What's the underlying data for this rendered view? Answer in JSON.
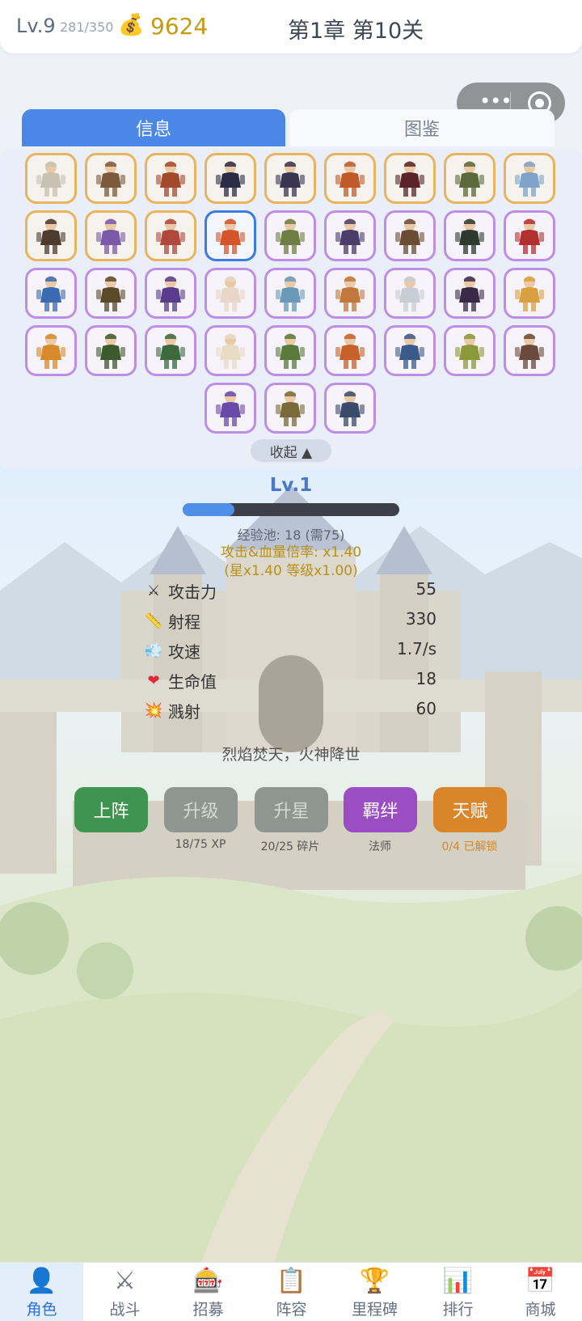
{
  "player": {
    "level": "Lv.9",
    "xp": "281/350",
    "coin_icon": "money-bag-icon",
    "gold": "9624"
  },
  "stage": {
    "label": "第1章 第10关"
  },
  "tabs": [
    {
      "label": "信息",
      "active": true
    },
    {
      "label": "图鉴",
      "active": false
    }
  ],
  "roster": {
    "collapse_label": "收起 ▲",
    "rows": [
      [
        {
          "rarity": "gold",
          "color": "#c9c2b0"
        },
        {
          "rarity": "gold",
          "color": "#7d5a3c"
        },
        {
          "rarity": "gold",
          "color": "#a44a2c"
        },
        {
          "rarity": "gold",
          "color": "#2c2c44"
        },
        {
          "rarity": "gold",
          "color": "#3a3550"
        },
        {
          "rarity": "gold",
          "color": "#c05a2a"
        },
        {
          "rarity": "gold",
          "color": "#5a2428"
        },
        {
          "rarity": "gold",
          "color": "#5b6a3a"
        },
        {
          "rarity": "gold",
          "color": "#7fa3c9"
        }
      ],
      [
        {
          "rarity": "gold",
          "color": "#4e3a2e"
        },
        {
          "rarity": "gold",
          "color": "#7a5aa8"
        },
        {
          "rarity": "gold",
          "color": "#b0483c"
        },
        {
          "rarity": "selected",
          "color": "#d4552a"
        },
        {
          "rarity": "purple",
          "color": "#6f7f44"
        },
        {
          "rarity": "purple",
          "color": "#4c3c6a"
        },
        {
          "rarity": "purple",
          "color": "#6a4c34"
        },
        {
          "rarity": "purple",
          "color": "#2e3a2e"
        },
        {
          "rarity": "purple",
          "color": "#b23030"
        }
      ],
      [
        {
          "rarity": "purple",
          "color": "#3c6ab0"
        },
        {
          "rarity": "purple",
          "color": "#5a4a2a"
        },
        {
          "rarity": "purple",
          "color": "#5a3c8c"
        },
        {
          "rarity": "purple",
          "color": "#e8d6c8"
        },
        {
          "rarity": "purple",
          "color": "#6a9ab8"
        },
        {
          "rarity": "purple",
          "color": "#c0783c"
        },
        {
          "rarity": "purple",
          "color": "#c8ccd4"
        },
        {
          "rarity": "purple",
          "color": "#3a2a4a"
        },
        {
          "rarity": "purple",
          "color": "#d8a040"
        }
      ],
      [
        {
          "rarity": "purple",
          "color": "#d88a2a"
        },
        {
          "rarity": "purple",
          "color": "#3c5a2c"
        },
        {
          "rarity": "purple",
          "color": "#3c6a3c"
        },
        {
          "rarity": "purple",
          "color": "#e8dcc4"
        },
        {
          "rarity": "purple",
          "color": "#5a7a3c"
        },
        {
          "rarity": "purple",
          "color": "#c8602a"
        },
        {
          "rarity": "purple",
          "color": "#3a5a8a"
        },
        {
          "rarity": "purple",
          "color": "#8a9a3a"
        },
        {
          "rarity": "purple",
          "color": "#6a4a3a"
        }
      ],
      [
        {
          "rarity": "purple",
          "color": "#6a4aa8"
        },
        {
          "rarity": "purple",
          "color": "#7a6a3a"
        },
        {
          "rarity": "purple",
          "color": "#3a4a6a"
        }
      ]
    ]
  },
  "hero": {
    "level": "Lv.1",
    "xp_fraction": 0.24,
    "xp_pool": "经验池: 18 (需75)",
    "multiplier": "攻击&血量倍率: x1.40",
    "multiplier_detail": "(星x1.40  等级x1.00)",
    "stats": [
      {
        "icon": "swords-icon",
        "glyph": "⚔",
        "label": "攻击力",
        "value": "55"
      },
      {
        "icon": "ruler-icon",
        "glyph": "📏",
        "label": "射程",
        "value": "330"
      },
      {
        "icon": "wind-icon",
        "glyph": "💨",
        "label": "攻速",
        "value": "1.7/s"
      },
      {
        "icon": "heart-icon",
        "glyph": "❤",
        "label": "生命值",
        "value": "18"
      },
      {
        "icon": "burst-icon",
        "glyph": "💥",
        "label": "溅射",
        "value": "60"
      }
    ],
    "motto": "烈焰焚天，火神降世"
  },
  "actions": {
    "deploy": {
      "label": "上阵",
      "sub": ""
    },
    "upgrade": {
      "label": "升级",
      "sub": "18/75 XP"
    },
    "star": {
      "label": "升星",
      "sub": "20/25 碎片"
    },
    "bond": {
      "label": "羁绊",
      "sub": "法师"
    },
    "talent": {
      "label": "天赋",
      "sub": "0/4 已解锁"
    }
  },
  "nav": [
    {
      "label": "角色",
      "icon": "person-icon",
      "glyph": "👤",
      "active": true
    },
    {
      "label": "战斗",
      "icon": "crossed-swords-icon",
      "glyph": "⚔",
      "active": false
    },
    {
      "label": "招募",
      "icon": "slot-machine-icon",
      "glyph": "🎰",
      "active": false
    },
    {
      "label": "阵容",
      "icon": "clipboard-icon",
      "glyph": "📋",
      "active": false
    },
    {
      "label": "里程碑",
      "icon": "trophy-icon",
      "glyph": "🏆",
      "active": false
    },
    {
      "label": "排行",
      "icon": "bar-chart-icon",
      "glyph": "📊",
      "active": false
    },
    {
      "label": "商城",
      "icon": "calendar-shop-icon",
      "glyph": "📅",
      "active": false
    }
  ],
  "colors": {
    "accent": "#4a87e6",
    "gold": "#c79a12",
    "deploy": "#3f9450",
    "disabled": "#8f9591",
    "bond": "#9a4ec2",
    "talent": "#d9862a"
  }
}
